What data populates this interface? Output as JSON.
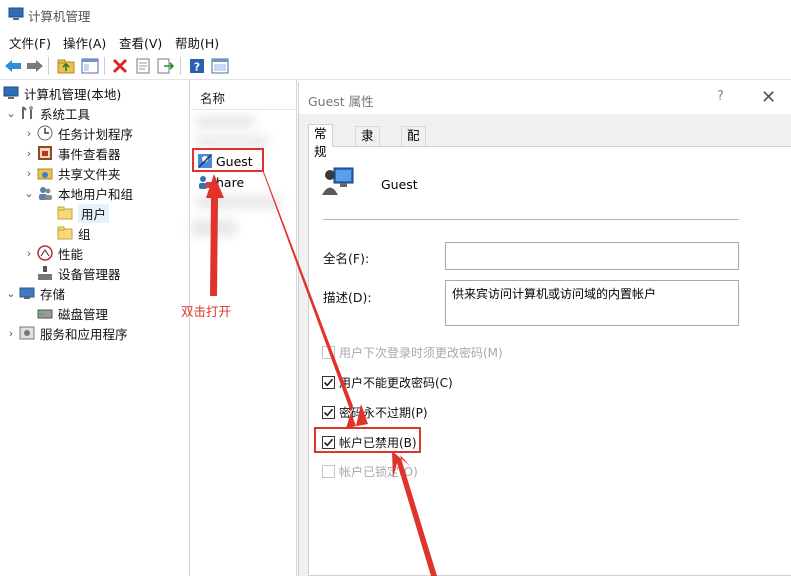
{
  "window": {
    "title": "计算机管理"
  },
  "menu": {
    "items": [
      "文件(F)",
      "操作(A)",
      "查看(V)",
      "帮助(H)"
    ]
  },
  "toolbar": {
    "buttons": [
      "back-arrow-icon",
      "forward-arrow-icon",
      "up-folder-icon",
      "show-hide-tree-icon",
      "delete-icon",
      "properties-icon",
      "export-icon",
      "help-icon",
      "view-icon"
    ]
  },
  "tree": {
    "root": "计算机管理(本地)",
    "items": [
      {
        "label": "系统工具"
      },
      {
        "label": "任务计划程序"
      },
      {
        "label": "事件查看器"
      },
      {
        "label": "共享文件夹"
      },
      {
        "label": "本地用户和组"
      },
      {
        "label": "用户"
      },
      {
        "label": "组"
      },
      {
        "label": "性能"
      },
      {
        "label": "设备管理器"
      },
      {
        "label": "存储"
      },
      {
        "label": "磁盘管理"
      },
      {
        "label": "服务和应用程序"
      }
    ]
  },
  "list": {
    "column_header": "名称",
    "items": [
      {
        "label": "Guest"
      },
      {
        "label": "hare"
      }
    ]
  },
  "dialog": {
    "title": "Guest 属性",
    "help": "?",
    "close": "✕",
    "tabs": [
      "常规",
      "隶属于",
      "配置文件"
    ],
    "active_tab": "常规",
    "user_name": "Guest",
    "full_name_label": "全名(F):",
    "full_name_value": "",
    "description_label": "描述(D):",
    "description_value": "供来宾访问计算机或访问域的内置帐户",
    "checkboxes": [
      {
        "label": "用户下次登录时须更改密码(M)",
        "checked": false,
        "disabled": true
      },
      {
        "label": "用户不能更改密码(C)",
        "checked": true,
        "disabled": false
      },
      {
        "label": "密码永不过期(P)",
        "checked": true,
        "disabled": false
      },
      {
        "label": "帐户已禁用(B)",
        "checked": true,
        "disabled": false
      },
      {
        "label": "帐户已锁定(O)",
        "checked": false,
        "disabled": true
      }
    ]
  },
  "annotation": {
    "text": "双击打开",
    "color": "#e0332b"
  }
}
